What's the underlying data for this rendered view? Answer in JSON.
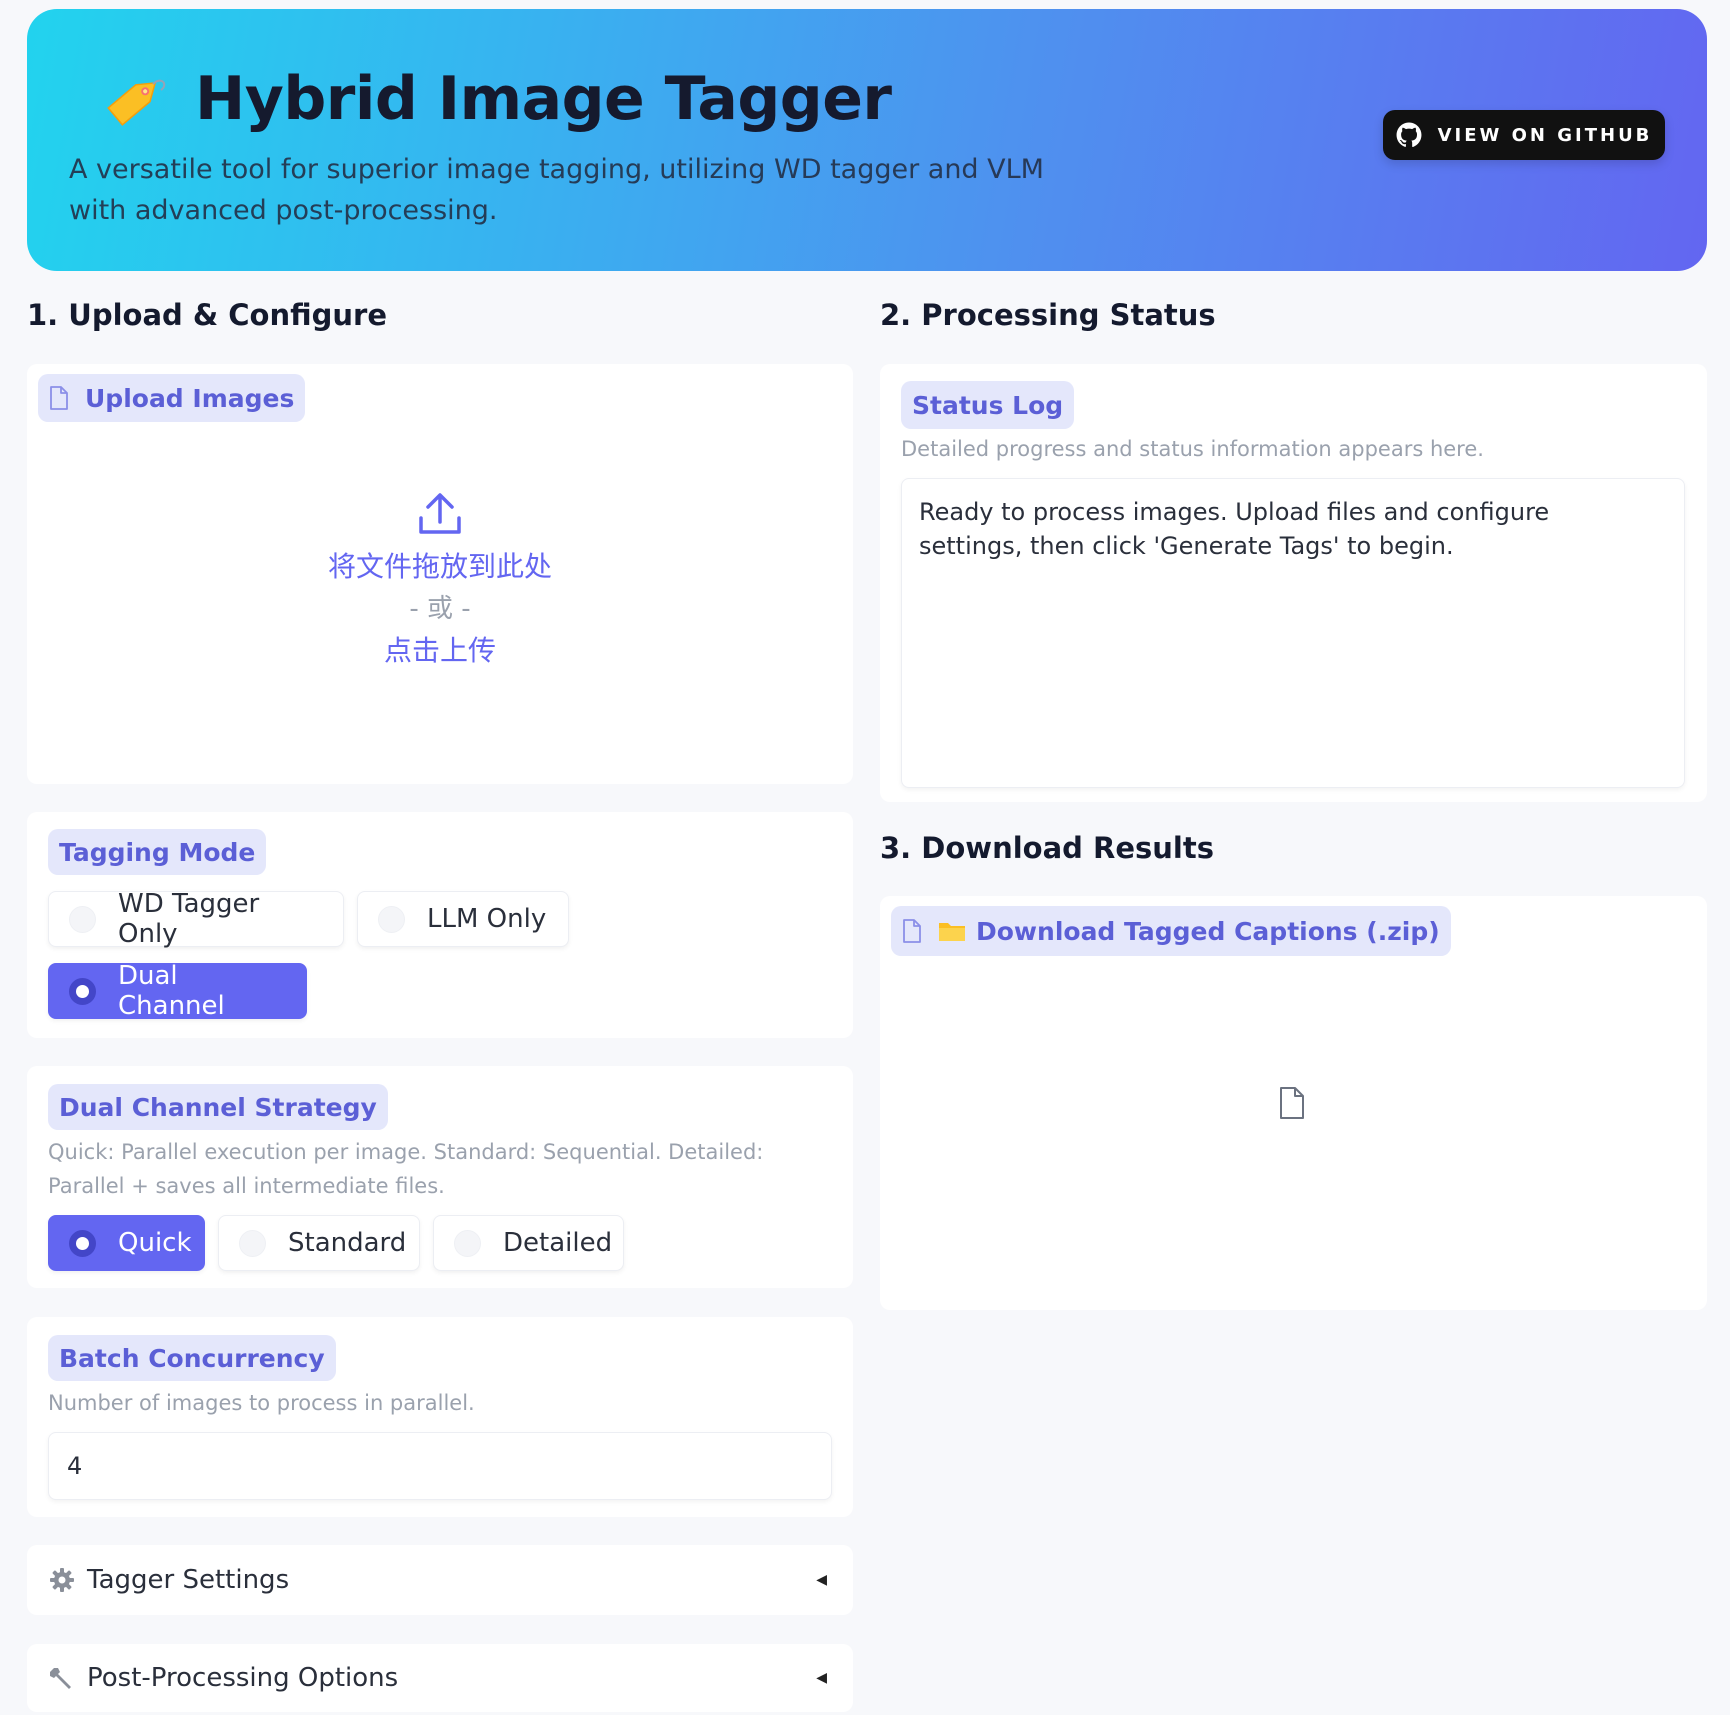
{
  "hero": {
    "title": "Hybrid Image Tagger",
    "subtitle_line1": "A versatile tool for superior image tagging, utilizing WD tagger and VLM",
    "subtitle_line2": "with advanced post-processing.",
    "github_label": "VIEW ON GITHUB",
    "icon": "tag-icon"
  },
  "left": {
    "title": "1. Upload & Configure",
    "upload": {
      "label": "Upload Images",
      "drop_text": "将文件拖放到此处",
      "or_text": "- 或 -",
      "click_text": "点击上传"
    },
    "tagging_mode": {
      "label": "Tagging Mode",
      "options": [
        "WD Tagger Only",
        "LLM Only",
        "Dual Channel"
      ],
      "selected": "Dual Channel"
    },
    "strategy": {
      "label": "Dual Channel Strategy",
      "desc_line1": "Quick: Parallel execution per image. Standard: Sequential. Detailed:",
      "desc_line2": "Parallel + saves all intermediate files.",
      "options": [
        "Quick",
        "Standard",
        "Detailed"
      ],
      "selected": "Quick"
    },
    "concurrency": {
      "label": "Batch Concurrency",
      "desc": "Number of images to process in parallel.",
      "value": "4"
    },
    "accordions": [
      {
        "label": "Tagger Settings",
        "icon": "gear-icon"
      },
      {
        "label": "Post-Processing Options",
        "icon": "wrench-icon"
      }
    ]
  },
  "right": {
    "status_title": "2. Processing Status",
    "status_log": {
      "label": "Status Log",
      "desc": "Detailed progress and status information appears here.",
      "text_line1": "Ready to process images. Upload files and configure",
      "text_line2": "settings, then click 'Generate Tags' to begin."
    },
    "download_title": "3. Download Results",
    "download": {
      "label": "Download Tagged Captions (.zip)"
    }
  },
  "colors": {
    "accent": "#6366f1",
    "pill_bg": "#e4e7fb",
    "gradient_start": "#22d3ee",
    "gradient_end": "#6366f1"
  }
}
